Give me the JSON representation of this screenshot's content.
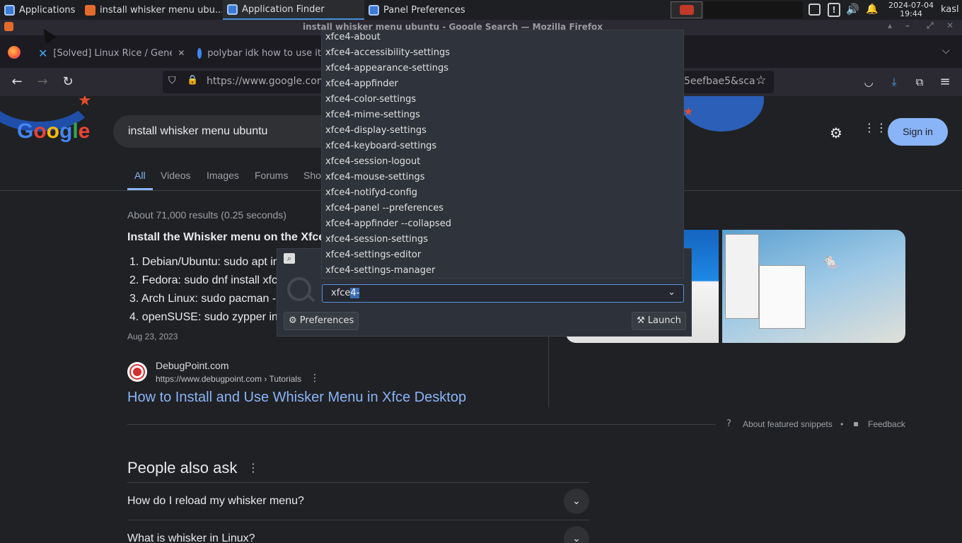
{
  "panel": {
    "tasks": [
      {
        "label": "Applications"
      },
      {
        "label": "install whisker menu ubu..."
      },
      {
        "label": "Application Finder"
      },
      {
        "label": "Panel Preferences"
      }
    ],
    "clock_date": "2024-07-04",
    "clock_time": "19:44",
    "user": "kasl"
  },
  "firefox": {
    "window_title": "install whisker menu ubuntu - Google Search — Mozilla Firefox",
    "tabs": [
      {
        "label": "[Solved] Linux Rice / Gener"
      },
      {
        "label": "polybar idk how to use it"
      }
    ],
    "url_start": "https://www.google.com/",
    "url_end": "5eefbae5&sca"
  },
  "google": {
    "logo": "Google",
    "search_value": "install whisker menu ubuntu",
    "sign_in": "Sign in",
    "tabs": [
      "All",
      "Videos",
      "Images",
      "Forums",
      "Sho"
    ],
    "result_stats": "About 71,000 results (0.25 seconds)",
    "snippet_title": "Install the Whisker menu on the Xfce",
    "snippet_items": [
      "1. Debian/Ubuntu: sudo apt in",
      "2. Fedora: sudo dnf install xfc",
      "3. Arch Linux: sudo pacman -",
      "4. openSUSE: sudo zypper in"
    ],
    "snippet_date": "Aug 23, 2023",
    "source_name": "DebugPoint.com",
    "source_url": "https://www.debugpoint.com › Tutorials",
    "result_link": "How to Install and Use Whisker Menu in Xfce Desktop",
    "about_snippets": "About featured snippets",
    "bullet": "•",
    "feedback": "Feedback",
    "paa_title": "People also ask",
    "paa_questions": [
      "How do I reload my whisker menu?",
      "What is whisker in Linux?"
    ]
  },
  "finder": {
    "input_value_plain": "xfce",
    "input_value_selected": "4-",
    "preferences_label": "Preferences",
    "launch_label": "Launch",
    "suggestions": [
      "xfce4-about",
      "xfce4-accessibility-settings",
      "xfce4-appearance-settings",
      "xfce4-appfinder",
      "xfce4-color-settings",
      "xfce4-mime-settings",
      "xfce4-display-settings",
      "xfce4-keyboard-settings",
      "xfce4-session-logout",
      "xfce4-mouse-settings",
      "xfce4-notifyd-config",
      "xfce4-panel --preferences",
      "xfce4-appfinder --collapsed",
      "xfce4-session-settings",
      "xfce4-settings-editor",
      "xfce4-settings-manager"
    ]
  },
  "colors": {
    "accent_blue": "#8ab4f8",
    "selection": "#3d6eb5",
    "google_blue": "#4285f4",
    "google_red": "#ea4335",
    "google_yellow": "#fbbc05",
    "google_green": "#34a853"
  }
}
